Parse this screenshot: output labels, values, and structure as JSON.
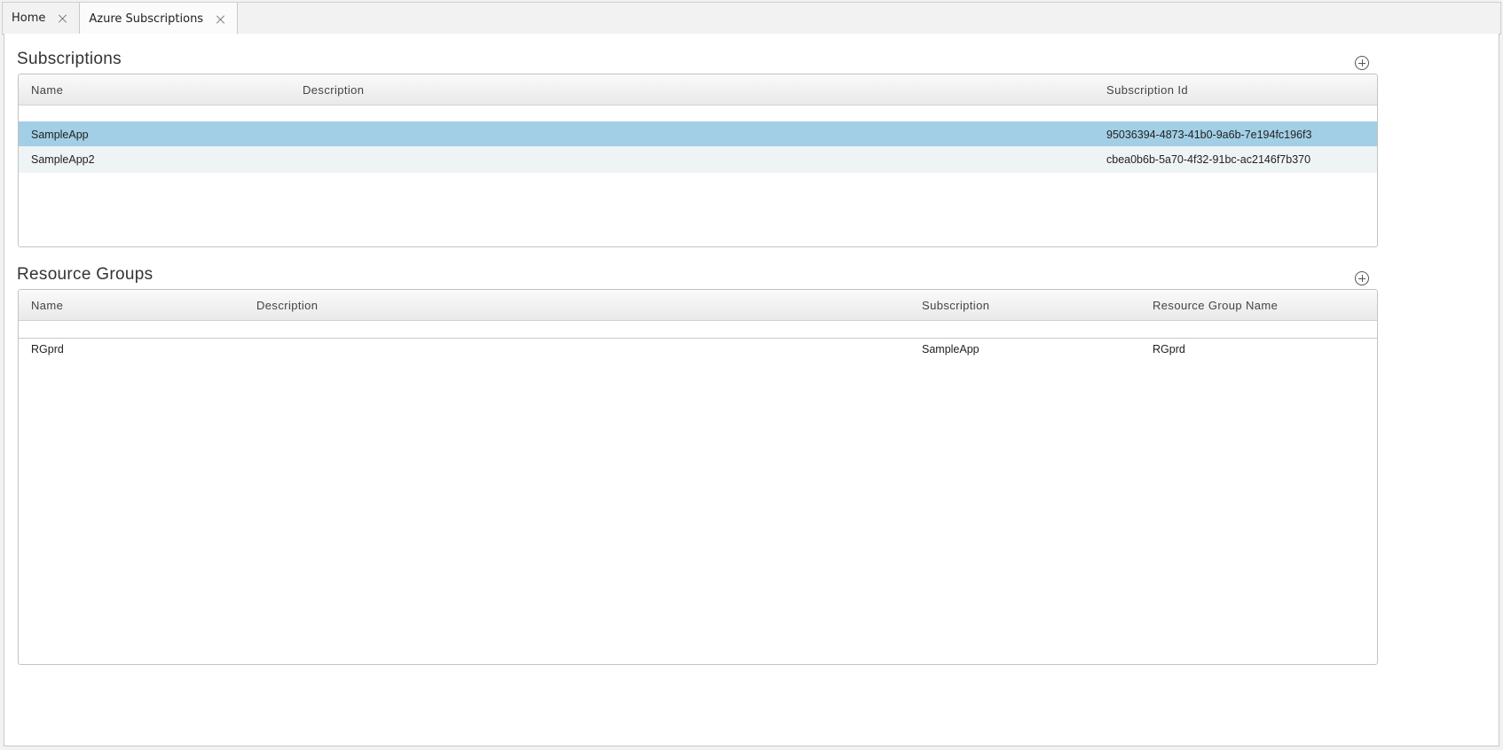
{
  "tabs": [
    {
      "label": "Home"
    },
    {
      "label": "Azure Subscriptions"
    }
  ],
  "subscriptions": {
    "title": "Subscriptions",
    "columns": [
      "Name",
      "Description",
      "Subscription Id"
    ],
    "rows": [
      {
        "name": "SampleApp",
        "description": "",
        "subscription_id": "95036394-4873-41b0-9a6b-7e194fc196f3",
        "state": "selected"
      },
      {
        "name": "SampleApp2",
        "description": "",
        "subscription_id": "cbea0b6b-5a70-4f32-91bc-ac2146f7b370",
        "state": "alternate"
      }
    ]
  },
  "resource_groups": {
    "title": "Resource Groups",
    "columns": [
      "Name",
      "Description",
      "Subscription",
      "Resource Group Name"
    ],
    "rows": [
      {
        "name": "RGprd",
        "description": "",
        "subscription": "SampleApp",
        "resource_group_name": "RGprd"
      }
    ]
  },
  "colors": {
    "selected_row": "#a2cfe5",
    "alternate_row": "#eef3f6"
  }
}
